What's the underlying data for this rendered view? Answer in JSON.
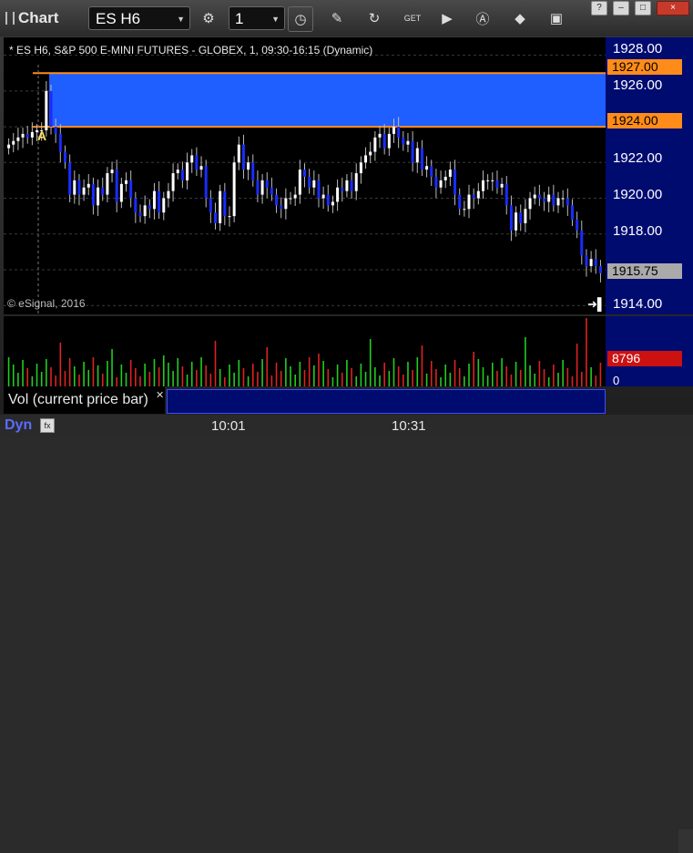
{
  "app": {
    "title": "Chart"
  },
  "toolbar": {
    "symbol": "ES H6",
    "interval": "1",
    "icons": [
      "settings-icon",
      "clock-icon",
      "pencil-icon",
      "refresh-icon",
      "get-icon",
      "play-icon",
      "text-icon",
      "diamond-icon",
      "camera-icon"
    ]
  },
  "window_controls": {
    "help": "?",
    "minimize": "–",
    "maximize": "□",
    "close": "×"
  },
  "chart": {
    "label": "* ES H6, S&P 500 E-MINI FUTURES - GLOBEX, 1, 09:30-16:15 (Dynamic)",
    "copyright": "© eSignal, 2016",
    "marker": "A",
    "y_ticks": [
      "1928.00",
      "1926.00",
      "1922.00",
      "1920.00",
      "1918.00",
      "1914.00"
    ],
    "zone_top_tag": "1927.00",
    "zone_bottom_tag": "1924.00",
    "price_tag": "1915.75",
    "x_ticks": [
      "10:01",
      "10:31"
    ],
    "colors": {
      "zone": "#1f5eff",
      "zone_line": "#ff8c1a",
      "up": "#ffffff",
      "down": "#1a2cff",
      "axis": "#000b70"
    }
  },
  "chart_data": {
    "type": "candlestick",
    "title": "",
    "ylim": [
      1913.5,
      1929
    ],
    "zone": [
      1924.0,
      1927.0
    ],
    "last_price": 1915.75,
    "x_ticks": [
      "10:01",
      "10:31"
    ],
    "closes": [
      1923.0,
      1923.2,
      1923.4,
      1923.6,
      1923.4,
      1923.7,
      1923.8,
      1923.8,
      1926.0,
      1924.0,
      1923.6,
      1922.6,
      1922.0,
      1920.2,
      1921.0,
      1920.2,
      1920.6,
      1920.8,
      1919.6,
      1920.6,
      1920.2,
      1921.4,
      1921.6,
      1919.8,
      1920.8,
      1921.0,
      1920.0,
      1919.2,
      1919.0,
      1919.6,
      1919.4,
      1920.4,
      1919.2,
      1920.0,
      1920.4,
      1921.4,
      1921.6,
      1921.0,
      1922.0,
      1922.4,
      1921.6,
      1921.8,
      1920.0,
      1919.2,
      1918.6,
      1920.4,
      1919.0,
      1919.0,
      1922.0,
      1923.0,
      1921.6,
      1922.0,
      1921.0,
      1920.2,
      1921.0,
      1920.6,
      1920.2,
      1919.6,
      1919.4,
      1920.0,
      1920.0,
      1920.2,
      1921.6,
      1921.2,
      1920.6,
      1921.0,
      1920.0,
      1920.2,
      1919.6,
      1919.8,
      1920.6,
      1920.4,
      1921.0,
      1920.4,
      1921.4,
      1922.0,
      1922.4,
      1922.6,
      1923.4,
      1923.6,
      1922.8,
      1923.6,
      1924.0,
      1923.4,
      1923.0,
      1923.2,
      1922.0,
      1922.8,
      1921.6,
      1921.8,
      1921.2,
      1920.6,
      1921.0,
      1921.2,
      1921.6,
      1920.2,
      1919.4,
      1919.4,
      1920.2,
      1920.0,
      1920.4,
      1921.0,
      1921.0,
      1921.0,
      1920.6,
      1920.8,
      1919.6,
      1918.2,
      1919.2,
      1918.6,
      1919.4,
      1920.0,
      1920.2,
      1920.0,
      1919.8,
      1920.2,
      1919.6,
      1920.0,
      1920.0,
      1919.6,
      1918.8,
      1918.2,
      1916.8,
      1916.2,
      1916.6,
      1916.2,
      1915.8
    ]
  },
  "volume": {
    "legend": "Vol (current price bar)",
    "current_value": "8796",
    "zero_label": "0",
    "color_up": "#22cc22",
    "color_down": "#dd2222"
  },
  "status": {
    "dynamic": "Dyn"
  }
}
